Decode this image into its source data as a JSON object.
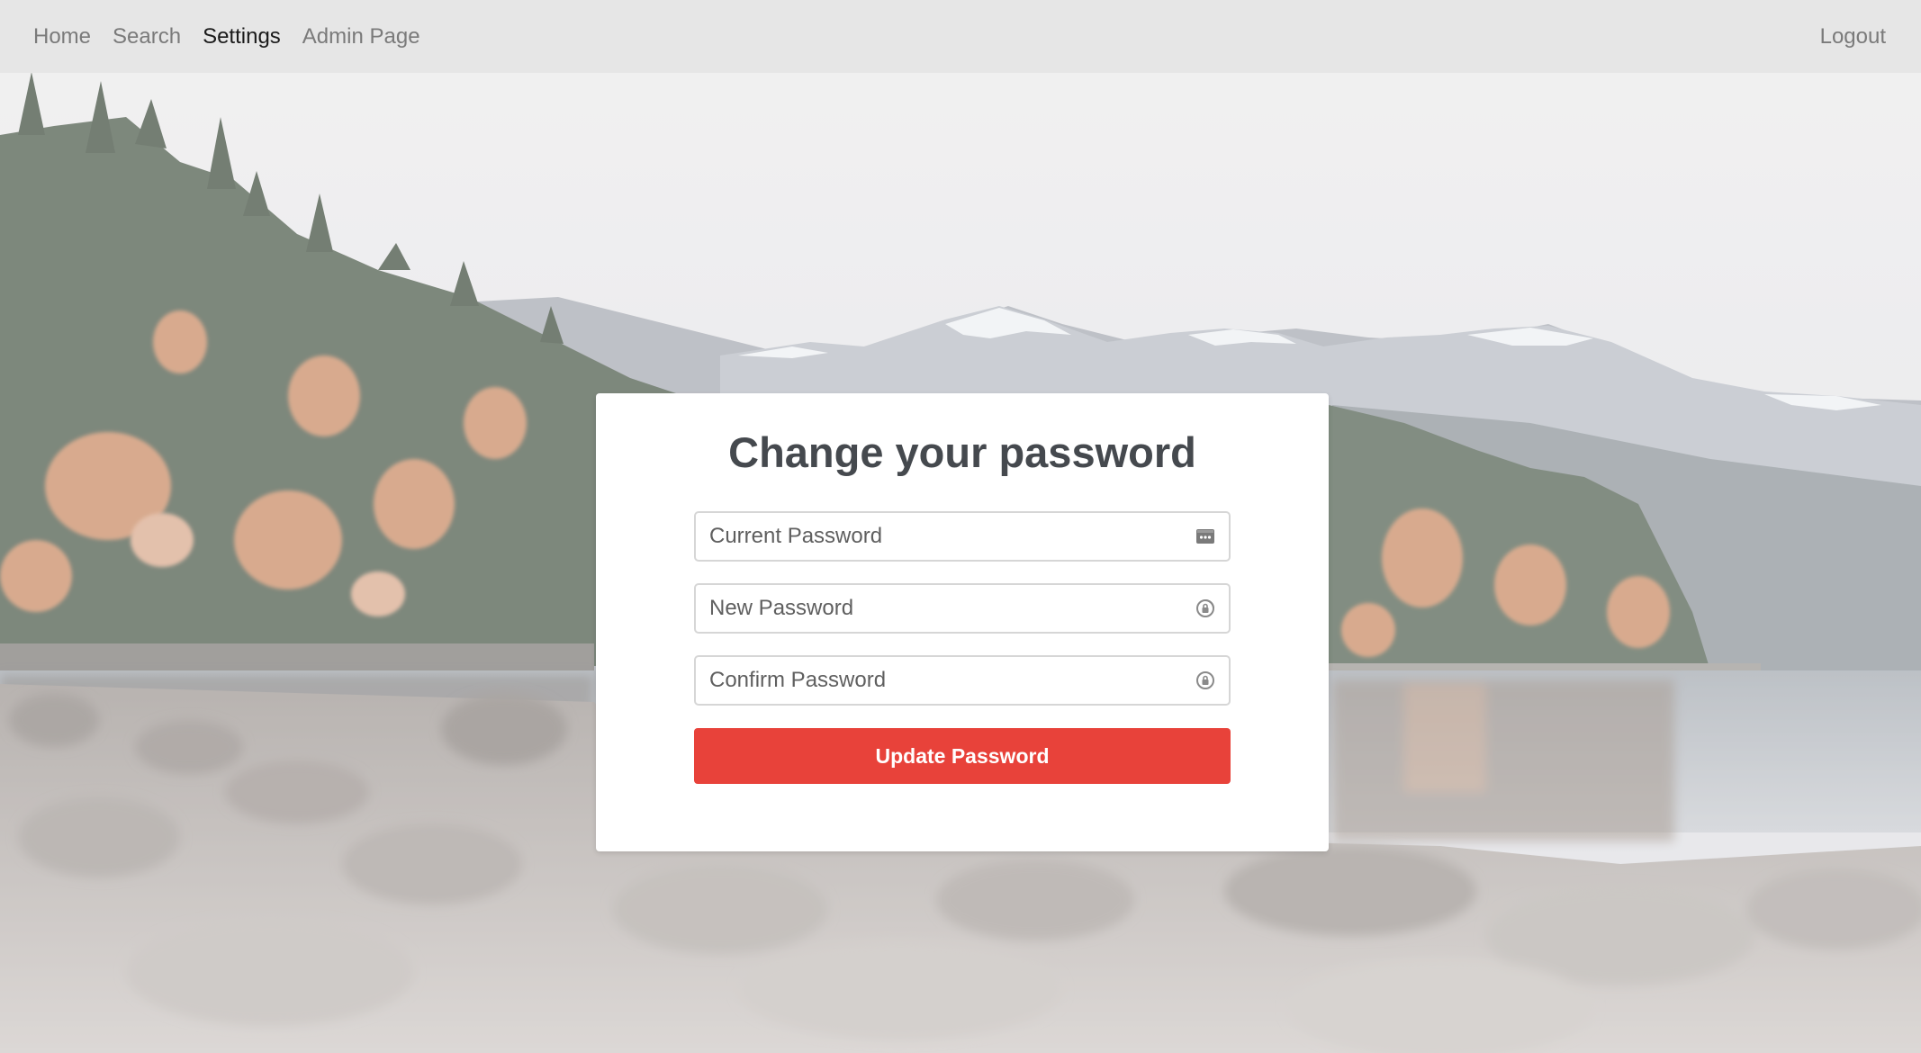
{
  "nav": {
    "links": [
      {
        "label": "Home",
        "active": false
      },
      {
        "label": "Search",
        "active": false
      },
      {
        "label": "Settings",
        "active": true
      },
      {
        "label": "Admin Page",
        "active": false
      }
    ],
    "logout_label": "Logout"
  },
  "form": {
    "title": "Change your password",
    "fields": [
      {
        "placeholder": "Current Password",
        "value": "",
        "icon": "password-manager-key-icon"
      },
      {
        "placeholder": "New Password",
        "value": "",
        "icon": "password-suggestion-icon"
      },
      {
        "placeholder": "Confirm Password",
        "value": "",
        "icon": "password-suggestion-icon"
      }
    ],
    "submit_label": "Update Password"
  },
  "colors": {
    "navbar_bg": "#e6e6e6",
    "nav_text": "#7a7a7a",
    "nav_active": "#1a1a1a",
    "title": "#45494e",
    "button_bg": "#e8423a",
    "button_text": "#ffffff"
  }
}
